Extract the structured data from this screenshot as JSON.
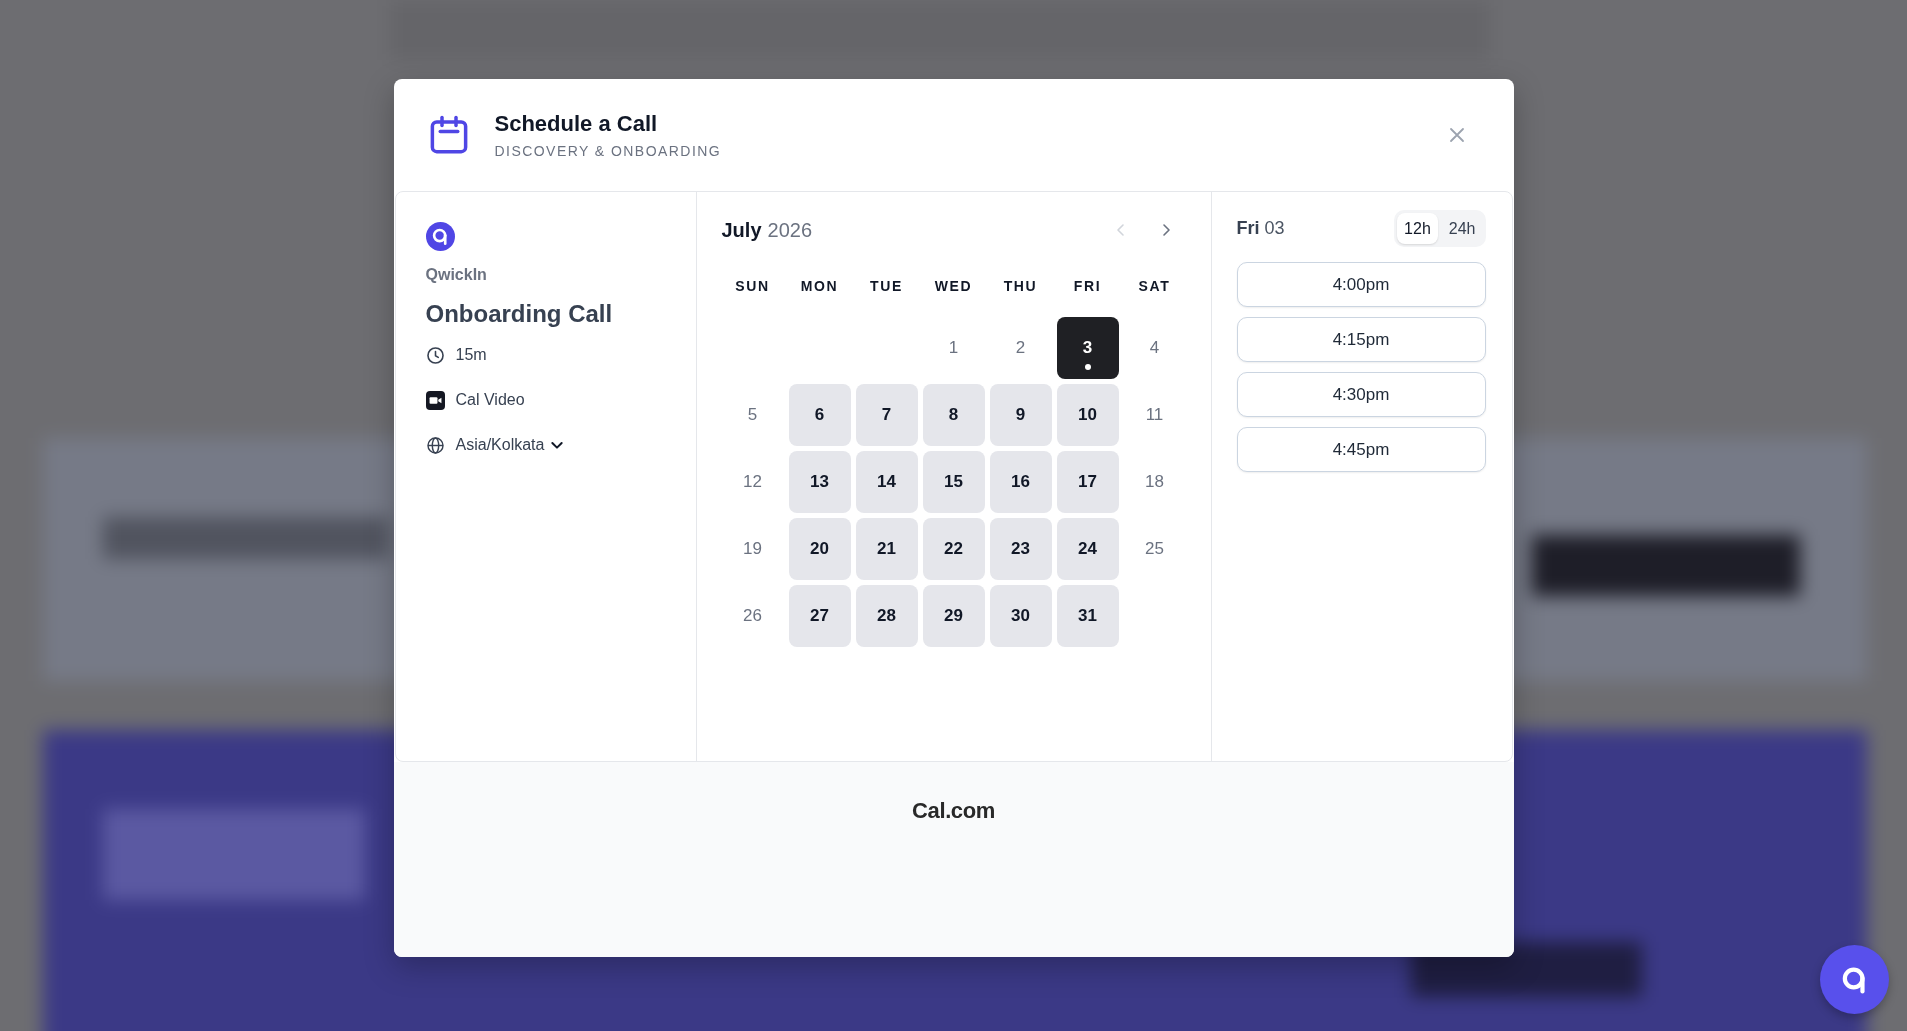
{
  "dialog": {
    "title": "Schedule a Call",
    "subtitle": "DISCOVERY & ONBOARDING"
  },
  "event": {
    "organizer": "QwickIn",
    "title": "Onboarding Call",
    "details": [
      {
        "kind": "duration",
        "text": "15m"
      },
      {
        "kind": "location",
        "text": "Cal Video"
      },
      {
        "kind": "timezone",
        "text": "Asia/Kolkata"
      }
    ]
  },
  "calendar": {
    "month": "July",
    "year": "2026",
    "prev": {
      "disabled": true
    },
    "next": {
      "disabled": false
    },
    "weekdays": [
      "SUN",
      "MON",
      "TUE",
      "WED",
      "THU",
      "FRI",
      "SAT"
    ],
    "weeks": [
      {
        "days": [
          {
            "day": "1",
            "available": false,
            "selected": false,
            "today": false
          },
          {
            "day": "2",
            "available": false,
            "selected": false,
            "today": false
          },
          {
            "day": "3",
            "available": true,
            "selected": true,
            "today": true
          },
          {
            "day": "4",
            "available": false,
            "selected": false,
            "today": false
          }
        ]
      },
      {
        "days": [
          {
            "day": "5",
            "available": false,
            "selected": false,
            "today": false
          },
          {
            "day": "6",
            "available": true,
            "selected": false,
            "today": false
          },
          {
            "day": "7",
            "available": true,
            "selected": false,
            "today": false
          },
          {
            "day": "8",
            "available": true,
            "selected": false,
            "today": false
          },
          {
            "day": "9",
            "available": true,
            "selected": false,
            "today": false
          },
          {
            "day": "10",
            "available": true,
            "selected": false,
            "today": false
          },
          {
            "day": "11",
            "available": false,
            "selected": false,
            "today": false
          }
        ]
      },
      {
        "days": [
          {
            "day": "12",
            "available": false,
            "selected": false,
            "today": false
          },
          {
            "day": "13",
            "available": true,
            "selected": false,
            "today": false
          },
          {
            "day": "14",
            "available": true,
            "selected": false,
            "today": false
          },
          {
            "day": "15",
            "available": true,
            "selected": false,
            "today": false
          },
          {
            "day": "16",
            "available": true,
            "selected": false,
            "today": false
          },
          {
            "day": "17",
            "available": true,
            "selected": false,
            "today": false
          },
          {
            "day": "18",
            "available": false,
            "selected": false,
            "today": false
          }
        ]
      },
      {
        "days": [
          {
            "day": "19",
            "available": false,
            "selected": false,
            "today": false
          },
          {
            "day": "20",
            "available": true,
            "selected": false,
            "today": false
          },
          {
            "day": "21",
            "available": true,
            "selected": false,
            "today": false
          },
          {
            "day": "22",
            "available": true,
            "selected": false,
            "today": false
          },
          {
            "day": "23",
            "available": true,
            "selected": false,
            "today": false
          },
          {
            "day": "24",
            "available": true,
            "selected": false,
            "today": false
          },
          {
            "day": "25",
            "available": false,
            "selected": false,
            "today": false
          }
        ]
      },
      {
        "days": [
          {
            "day": "26",
            "available": false,
            "selected": false,
            "today": false
          },
          {
            "day": "27",
            "available": true,
            "selected": false,
            "today": false
          },
          {
            "day": "28",
            "available": true,
            "selected": false,
            "today": false
          },
          {
            "day": "29",
            "available": true,
            "selected": false,
            "today": false
          },
          {
            "day": "30",
            "available": true,
            "selected": false,
            "today": false
          },
          {
            "day": "31",
            "available": true,
            "selected": false,
            "today": false
          }
        ]
      }
    ]
  },
  "times": {
    "weekday": "Fri",
    "date": "03",
    "formats": [
      {
        "label": "12h",
        "selected": true
      },
      {
        "label": "24h",
        "selected": false
      }
    ],
    "slots": [
      {
        "time": "4:00pm"
      },
      {
        "time": "4:15pm"
      },
      {
        "time": "4:30pm"
      },
      {
        "time": "4:45pm"
      }
    ]
  },
  "footer": {
    "brand": "Cal.com"
  }
}
